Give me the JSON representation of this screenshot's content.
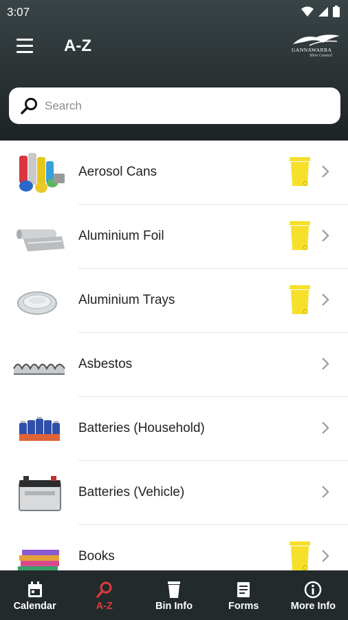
{
  "status_bar": {
    "time": "3:07"
  },
  "header": {
    "title": "A-Z",
    "logo_text": "GANNAWARRA",
    "logo_subtext": "Shire Council"
  },
  "search": {
    "placeholder": "Search",
    "value": ""
  },
  "items": [
    {
      "label": "Aerosol Cans",
      "image_icon": "aerosol-cans",
      "bin": "yellow-bin"
    },
    {
      "label": "Aluminium Foil",
      "image_icon": "aluminium-foil",
      "bin": "yellow-bin"
    },
    {
      "label": "Aluminium Trays",
      "image_icon": "aluminium-trays",
      "bin": "yellow-bin"
    },
    {
      "label": "Asbestos",
      "image_icon": "asbestos",
      "bin": null
    },
    {
      "label": "Batteries (Household)",
      "image_icon": "household-batteries",
      "bin": null
    },
    {
      "label": "Batteries (Vehicle)",
      "image_icon": "car-battery",
      "bin": null
    },
    {
      "label": "Books",
      "image_icon": "books",
      "bin": "yellow-bin"
    }
  ],
  "bottom_nav": {
    "items": [
      {
        "label": "Calendar",
        "icon": "calendar-icon",
        "active": false
      },
      {
        "label": "A-Z",
        "icon": "search-icon",
        "active": true
      },
      {
        "label": "Bin Info",
        "icon": "bin-icon",
        "active": false
      },
      {
        "label": "Forms",
        "icon": "forms-icon",
        "active": false
      },
      {
        "label": "More Info",
        "icon": "info-icon",
        "active": false
      }
    ]
  },
  "colors": {
    "header_bg": "#2b3335",
    "yellow_bin": "#f6e02a",
    "nav_bg": "#232a2c",
    "nav_active": "#e0393e"
  }
}
